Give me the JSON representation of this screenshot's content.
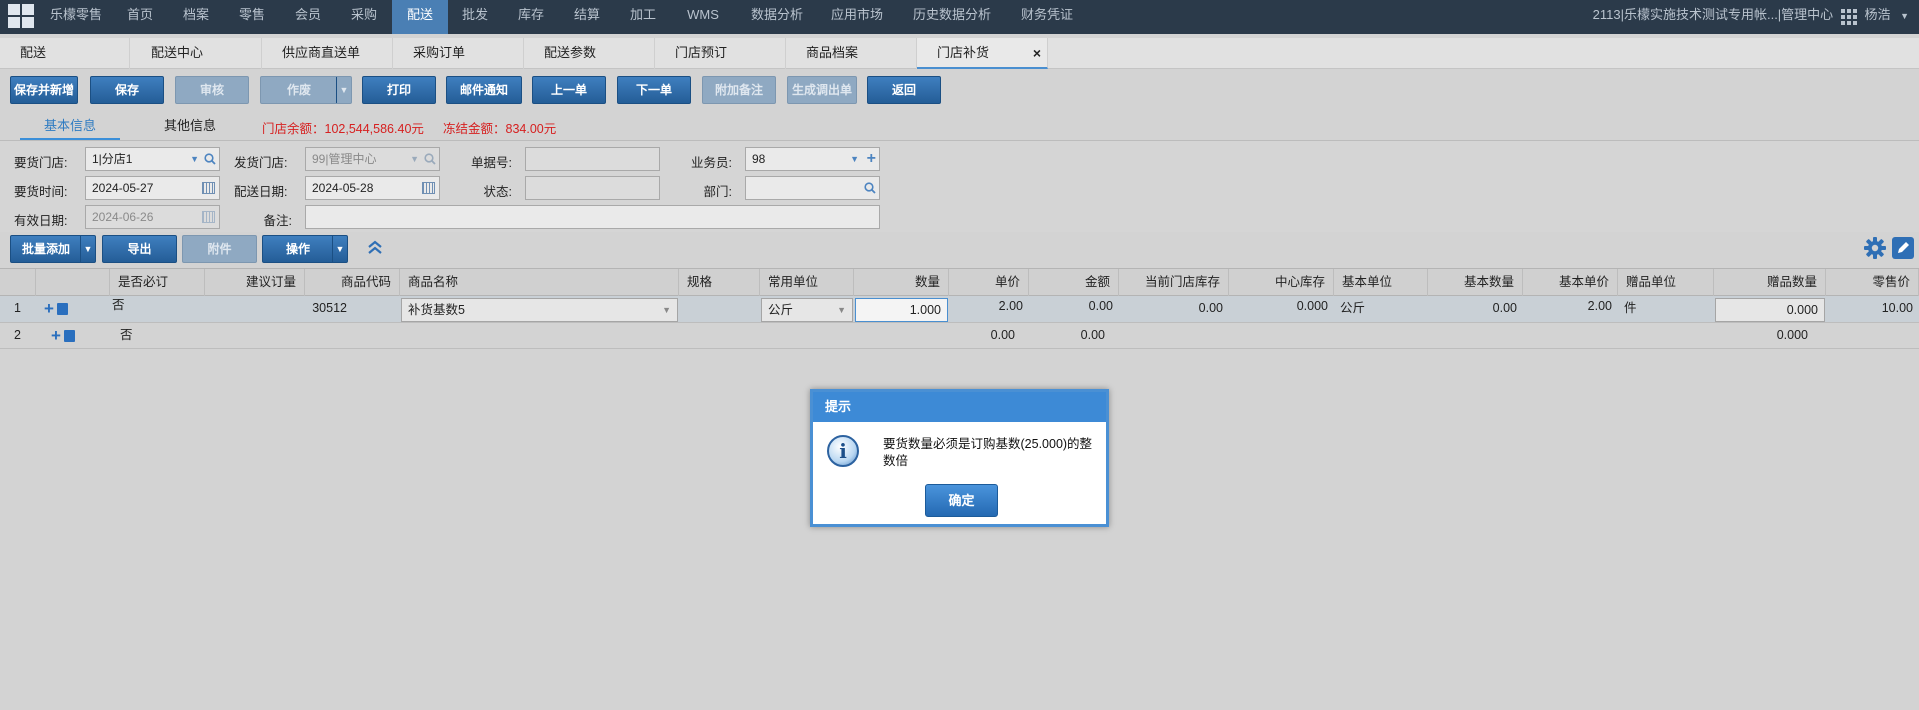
{
  "nav": {
    "items": [
      "乐檬零售",
      "首页",
      "档案",
      "零售",
      "会员",
      "采购",
      "配送",
      "批发",
      "库存",
      "结算",
      "加工",
      "WMS",
      "数据分析",
      "应用市场",
      "历史数据分析",
      "财务凭证"
    ],
    "active_index": 6,
    "account": "2113|乐檬实施技术测试专用帐...|管理中心",
    "user": "杨浩"
  },
  "tabs": [
    "配送",
    "配送中心",
    "供应商直送单",
    "采购订单",
    "配送参数",
    "门店预订",
    "商品档案",
    "门店补货"
  ],
  "active_tab": "门店补货",
  "toolbar": [
    "保存并新增",
    "保存",
    "审核",
    "作废",
    "打印",
    "邮件通知",
    "上一单",
    "下一单",
    "附加备注",
    "生成调出单",
    "返回"
  ],
  "info_tabs": [
    "基本信息",
    "其他信息"
  ],
  "balance": "门店余额：102,544,586.40元",
  "frozen": "冻结金额：834.00元",
  "form": {
    "req_store_label": "要货门店:",
    "req_store": "1|分店1",
    "send_store_label": "发货门店:",
    "send_store": "99|管理中心",
    "doc_no_label": "单据号:",
    "salesman_label": "业务员:",
    "salesman": "98",
    "req_time_label": "要货时间:",
    "req_time": "2024-05-27",
    "ship_date_label": "配送日期:",
    "ship_date": "2024-05-28",
    "status_label": "状态:",
    "dept_label": "部门:",
    "valid_label": "有效日期:",
    "valid_date": "2024-06-26",
    "remark_label": "备注:"
  },
  "grid_toolbar": [
    "批量添加",
    "导出",
    "附件",
    "操作"
  ],
  "columns": [
    "是否必订",
    "建议订量",
    "商品代码",
    "商品名称",
    "规格",
    "常用单位",
    "数量",
    "单价",
    "金额",
    "当前门店库存",
    "中心库存",
    "基本单位",
    "基本数量",
    "基本单价",
    "赠品单位",
    "赠品数量",
    "零售价"
  ],
  "rows": [
    {
      "no": "1",
      "required": "否",
      "code": "30512",
      "name": "补货基数5",
      "unit": "公斤",
      "qty": "1.000",
      "price": "2.00",
      "amount": "0.00",
      "store_stock": "0.00",
      "center_stock": "0.000",
      "base_unit": "公斤",
      "base_qty": "0.00",
      "base_price": "2.00",
      "gift_unit": "件",
      "gift_qty": "0.000",
      "retail": "10.00"
    },
    {
      "no": "2",
      "required": "否",
      "price": "0.00",
      "amount": "0.00",
      "gift_qty": "0.000"
    }
  ],
  "dialog": {
    "title": "提示",
    "message": "要货数量必须是订购基数(25.000)的整数倍",
    "ok": "确定"
  }
}
